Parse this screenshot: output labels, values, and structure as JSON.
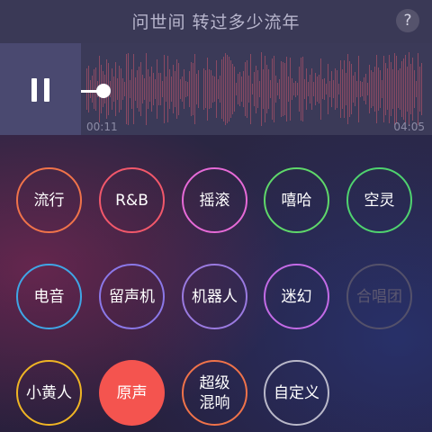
{
  "header": {
    "title": "问世间 转过多少流年",
    "help_label": "?"
  },
  "player": {
    "state": "playing",
    "current_time": "00:11",
    "total_time": "04:05",
    "progress": 0.045
  },
  "effects": [
    {
      "label": "流行",
      "color": "#f0734a",
      "selected": false,
      "disabled": false
    },
    {
      "label": "R&B",
      "color": "#f2586b",
      "selected": false,
      "disabled": false
    },
    {
      "label": "摇滚",
      "color": "#e66ad7",
      "selected": false,
      "disabled": false
    },
    {
      "label": "嘻哈",
      "color": "#5fd86a",
      "selected": false,
      "disabled": false
    },
    {
      "label": "空灵",
      "color": "#4fd36f",
      "selected": false,
      "disabled": false
    },
    {
      "label": "电音",
      "color": "#3fa6e6",
      "selected": false,
      "disabled": false
    },
    {
      "label": "留声机",
      "color": "#8b78e8",
      "selected": false,
      "disabled": false
    },
    {
      "label": "机器人",
      "color": "#9a7ae0",
      "selected": false,
      "disabled": false
    },
    {
      "label": "迷幻",
      "color": "#c36be6",
      "selected": false,
      "disabled": false
    },
    {
      "label": "合唱团",
      "color": "#54516a",
      "selected": false,
      "disabled": true
    },
    {
      "label": "小黄人",
      "color": "#f0b524",
      "selected": false,
      "disabled": false
    },
    {
      "label": "原声",
      "color": "#f4544f",
      "selected": true,
      "disabled": false
    },
    {
      "label": "超级\n混响",
      "color": "#f0734a",
      "selected": false,
      "disabled": false
    },
    {
      "label": "自定义",
      "color": "#b9b8c9",
      "selected": false,
      "disabled": false
    }
  ]
}
